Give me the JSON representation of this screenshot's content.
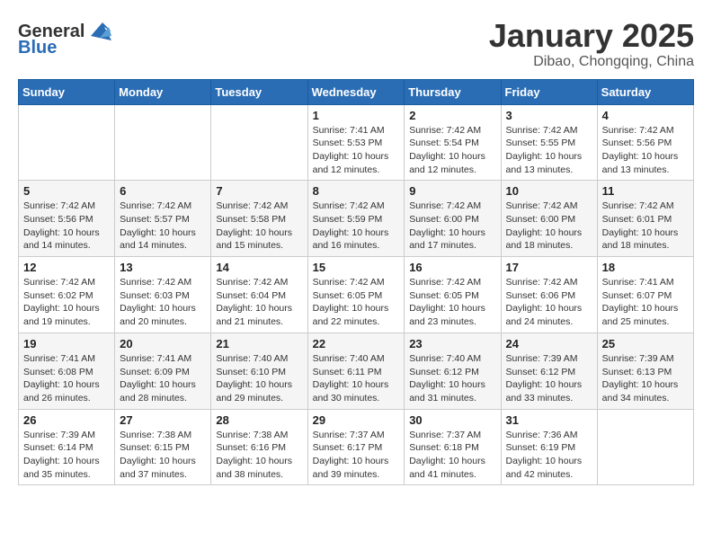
{
  "header": {
    "logo_general": "General",
    "logo_blue": "Blue",
    "title": "January 2025",
    "subtitle": "Dibao, Chongqing, China"
  },
  "weekdays": [
    "Sunday",
    "Monday",
    "Tuesday",
    "Wednesday",
    "Thursday",
    "Friday",
    "Saturday"
  ],
  "weeks": [
    [
      {
        "day": "",
        "info": ""
      },
      {
        "day": "",
        "info": ""
      },
      {
        "day": "",
        "info": ""
      },
      {
        "day": "1",
        "info": "Sunrise: 7:41 AM\nSunset: 5:53 PM\nDaylight: 10 hours\nand 12 minutes."
      },
      {
        "day": "2",
        "info": "Sunrise: 7:42 AM\nSunset: 5:54 PM\nDaylight: 10 hours\nand 12 minutes."
      },
      {
        "day": "3",
        "info": "Sunrise: 7:42 AM\nSunset: 5:55 PM\nDaylight: 10 hours\nand 13 minutes."
      },
      {
        "day": "4",
        "info": "Sunrise: 7:42 AM\nSunset: 5:56 PM\nDaylight: 10 hours\nand 13 minutes."
      }
    ],
    [
      {
        "day": "5",
        "info": "Sunrise: 7:42 AM\nSunset: 5:56 PM\nDaylight: 10 hours\nand 14 minutes."
      },
      {
        "day": "6",
        "info": "Sunrise: 7:42 AM\nSunset: 5:57 PM\nDaylight: 10 hours\nand 14 minutes."
      },
      {
        "day": "7",
        "info": "Sunrise: 7:42 AM\nSunset: 5:58 PM\nDaylight: 10 hours\nand 15 minutes."
      },
      {
        "day": "8",
        "info": "Sunrise: 7:42 AM\nSunset: 5:59 PM\nDaylight: 10 hours\nand 16 minutes."
      },
      {
        "day": "9",
        "info": "Sunrise: 7:42 AM\nSunset: 6:00 PM\nDaylight: 10 hours\nand 17 minutes."
      },
      {
        "day": "10",
        "info": "Sunrise: 7:42 AM\nSunset: 6:00 PM\nDaylight: 10 hours\nand 18 minutes."
      },
      {
        "day": "11",
        "info": "Sunrise: 7:42 AM\nSunset: 6:01 PM\nDaylight: 10 hours\nand 18 minutes."
      }
    ],
    [
      {
        "day": "12",
        "info": "Sunrise: 7:42 AM\nSunset: 6:02 PM\nDaylight: 10 hours\nand 19 minutes."
      },
      {
        "day": "13",
        "info": "Sunrise: 7:42 AM\nSunset: 6:03 PM\nDaylight: 10 hours\nand 20 minutes."
      },
      {
        "day": "14",
        "info": "Sunrise: 7:42 AM\nSunset: 6:04 PM\nDaylight: 10 hours\nand 21 minutes."
      },
      {
        "day": "15",
        "info": "Sunrise: 7:42 AM\nSunset: 6:05 PM\nDaylight: 10 hours\nand 22 minutes."
      },
      {
        "day": "16",
        "info": "Sunrise: 7:42 AM\nSunset: 6:05 PM\nDaylight: 10 hours\nand 23 minutes."
      },
      {
        "day": "17",
        "info": "Sunrise: 7:42 AM\nSunset: 6:06 PM\nDaylight: 10 hours\nand 24 minutes."
      },
      {
        "day": "18",
        "info": "Sunrise: 7:41 AM\nSunset: 6:07 PM\nDaylight: 10 hours\nand 25 minutes."
      }
    ],
    [
      {
        "day": "19",
        "info": "Sunrise: 7:41 AM\nSunset: 6:08 PM\nDaylight: 10 hours\nand 26 minutes."
      },
      {
        "day": "20",
        "info": "Sunrise: 7:41 AM\nSunset: 6:09 PM\nDaylight: 10 hours\nand 28 minutes."
      },
      {
        "day": "21",
        "info": "Sunrise: 7:40 AM\nSunset: 6:10 PM\nDaylight: 10 hours\nand 29 minutes."
      },
      {
        "day": "22",
        "info": "Sunrise: 7:40 AM\nSunset: 6:11 PM\nDaylight: 10 hours\nand 30 minutes."
      },
      {
        "day": "23",
        "info": "Sunrise: 7:40 AM\nSunset: 6:12 PM\nDaylight: 10 hours\nand 31 minutes."
      },
      {
        "day": "24",
        "info": "Sunrise: 7:39 AM\nSunset: 6:12 PM\nDaylight: 10 hours\nand 33 minutes."
      },
      {
        "day": "25",
        "info": "Sunrise: 7:39 AM\nSunset: 6:13 PM\nDaylight: 10 hours\nand 34 minutes."
      }
    ],
    [
      {
        "day": "26",
        "info": "Sunrise: 7:39 AM\nSunset: 6:14 PM\nDaylight: 10 hours\nand 35 minutes."
      },
      {
        "day": "27",
        "info": "Sunrise: 7:38 AM\nSunset: 6:15 PM\nDaylight: 10 hours\nand 37 minutes."
      },
      {
        "day": "28",
        "info": "Sunrise: 7:38 AM\nSunset: 6:16 PM\nDaylight: 10 hours\nand 38 minutes."
      },
      {
        "day": "29",
        "info": "Sunrise: 7:37 AM\nSunset: 6:17 PM\nDaylight: 10 hours\nand 39 minutes."
      },
      {
        "day": "30",
        "info": "Sunrise: 7:37 AM\nSunset: 6:18 PM\nDaylight: 10 hours\nand 41 minutes."
      },
      {
        "day": "31",
        "info": "Sunrise: 7:36 AM\nSunset: 6:19 PM\nDaylight: 10 hours\nand 42 minutes."
      },
      {
        "day": "",
        "info": ""
      }
    ]
  ]
}
